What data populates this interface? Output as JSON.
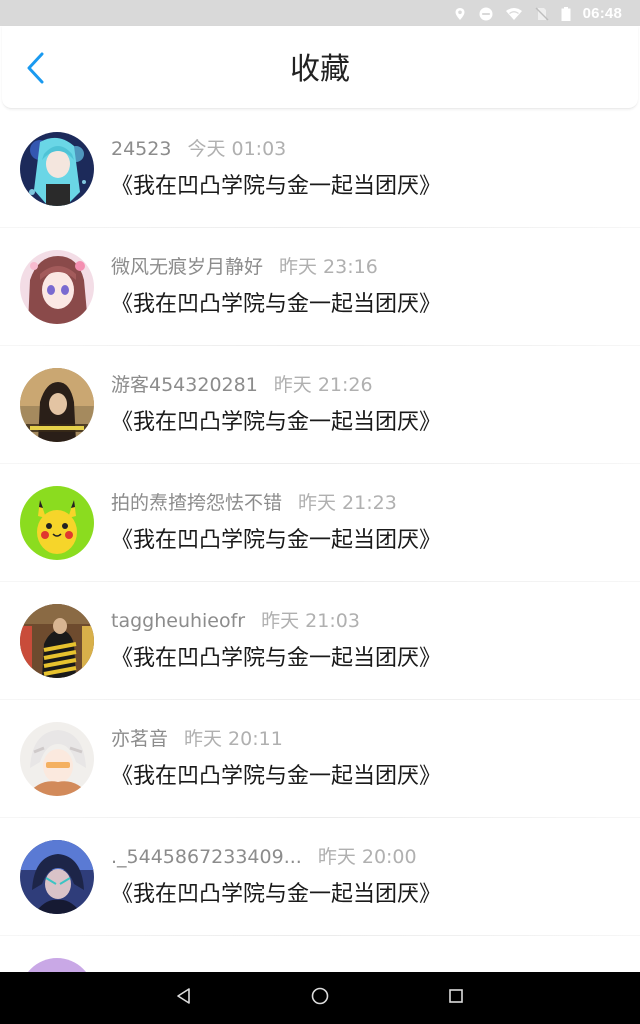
{
  "status_bar": {
    "time": "06:48",
    "icons": [
      "location-icon",
      "do-not-disturb-icon",
      "wifi-icon",
      "no-sim-icon",
      "battery-icon"
    ]
  },
  "header": {
    "title": "收藏",
    "back_icon": "chevron-left-icon",
    "accent_color": "#1a9af0"
  },
  "items": [
    {
      "user": "24523",
      "time": "今天 01:03",
      "title": "《我在凹凸学院与金一起当团厌》"
    },
    {
      "user": "微风无痕岁月静好",
      "time": "昨天 23:16",
      "title": "《我在凹凸学院与金一起当团厌》"
    },
    {
      "user": "游客454320281",
      "time": "昨天 21:26",
      "title": "《我在凹凸学院与金一起当团厌》"
    },
    {
      "user": "拍的焘揸挎怨怯不错",
      "time": "昨天 21:23",
      "title": "《我在凹凸学院与金一起当团厌》"
    },
    {
      "user": "taggheuhieofr",
      "time": "昨天 21:03",
      "title": "《我在凹凸学院与金一起当团厌》"
    },
    {
      "user": "亦茗音",
      "time": "昨天 20:11",
      "title": "《我在凹凸学院与金一起当团厌》"
    },
    {
      "user": "._5445867233409...",
      "time": "昨天 20:00",
      "title": "《我在凹凸学院与金一起当团厌》"
    }
  ],
  "nav_bar": {
    "icons": [
      "back-triangle-icon",
      "home-circle-icon",
      "recents-square-icon"
    ]
  }
}
